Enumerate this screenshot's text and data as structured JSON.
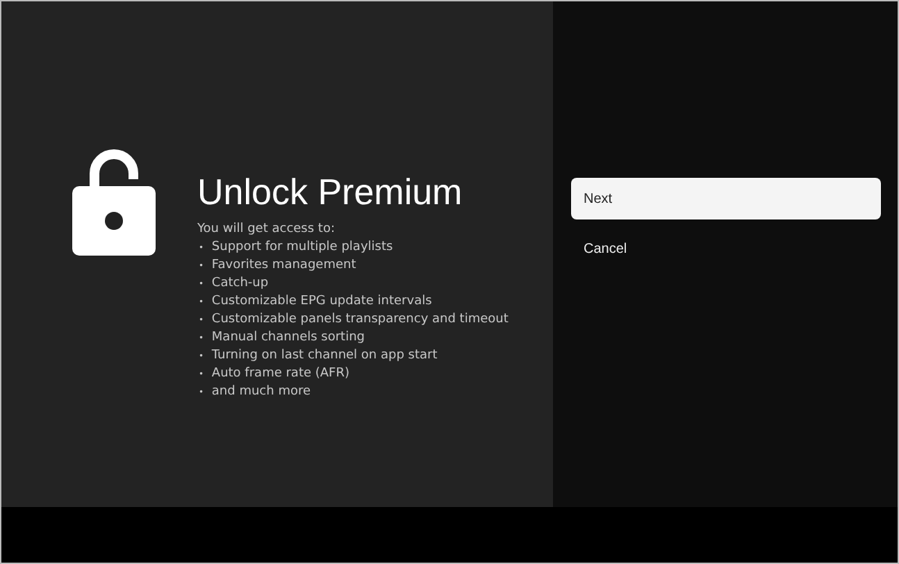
{
  "title": "Unlock Premium",
  "intro": "You will get access to:",
  "features": [
    {
      "bullet": "•",
      "text": "Support for multiple playlists"
    },
    {
      "bullet": "•",
      "text": "Favorites management"
    },
    {
      "bullet": "•",
      "text": "Catch-up"
    },
    {
      "bullet": "•",
      "text": "Customizable EPG update intervals"
    },
    {
      "bullet": "•",
      "text": "Customizable panels transparency and timeout"
    },
    {
      "bullet": "•",
      "text": "Manual channels sorting"
    },
    {
      "bullet": "•",
      "text": "Turning on last channel on app start"
    },
    {
      "bullet": "•",
      "text": "Auto frame rate (AFR)"
    },
    {
      "bullet": "•",
      "text": "and much more"
    }
  ],
  "actions": [
    {
      "label": "Next",
      "selected": true
    },
    {
      "label": "Cancel",
      "selected": false
    }
  ]
}
